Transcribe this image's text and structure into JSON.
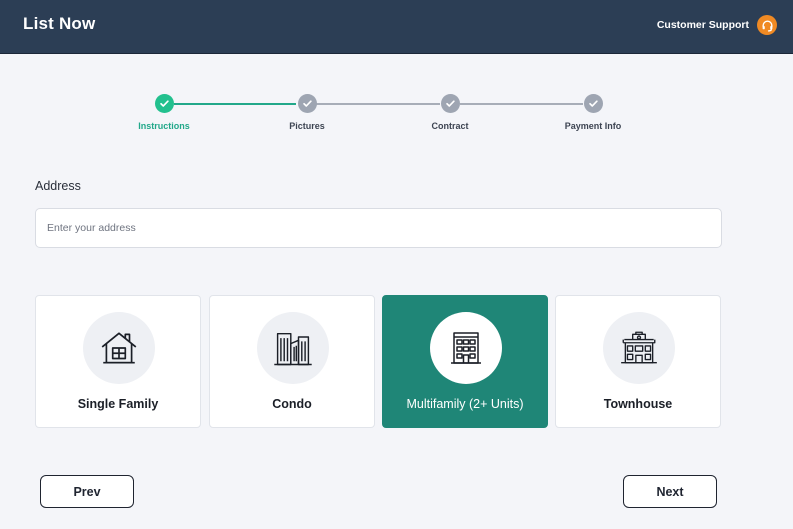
{
  "header": {
    "title": "List Now",
    "support_label": "Customer Support",
    "support_icon": "headset-icon"
  },
  "stepper": {
    "steps": [
      {
        "label": "Instructions",
        "status": "active"
      },
      {
        "label": "Pictures",
        "status": "completed"
      },
      {
        "label": "Contract",
        "status": "completed"
      },
      {
        "label": "Payment Info",
        "status": "completed"
      }
    ]
  },
  "address": {
    "label": "Address",
    "placeholder": "Enter your address",
    "value": ""
  },
  "property_types": {
    "selected": "Multifamily (2+ Units)",
    "options": [
      {
        "label": "Single Family",
        "icon": "house-icon"
      },
      {
        "label": "Condo",
        "icon": "condo-buildings-icon"
      },
      {
        "label": "Multifamily (2+ Units)",
        "icon": "apartment-building-icon"
      },
      {
        "label": "Townhouse",
        "icon": "townhouse-icon"
      }
    ]
  },
  "navigation": {
    "prev_label": "Prev",
    "next_label": "Next"
  },
  "colors": {
    "header_bg": "#2c3e55",
    "accent": "#22c08e",
    "selected_card": "#1f8677",
    "support_icon_bg": "#f08a24",
    "page_bg": "#f4f5f9"
  }
}
